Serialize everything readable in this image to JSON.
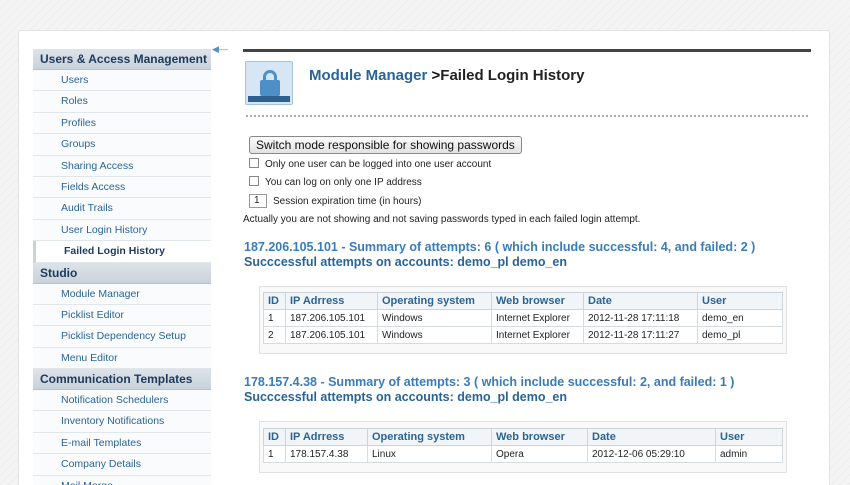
{
  "sidebar": {
    "sections": [
      {
        "title": "Users & Access Management",
        "items": [
          {
            "label": "Users",
            "active": false
          },
          {
            "label": "Roles",
            "active": false
          },
          {
            "label": "Profiles",
            "active": false
          },
          {
            "label": "Groups",
            "active": false
          },
          {
            "label": "Sharing Access",
            "active": false
          },
          {
            "label": "Fields Access",
            "active": false
          },
          {
            "label": "Audit Trails",
            "active": false
          },
          {
            "label": "User Login History",
            "active": false
          },
          {
            "label": "Failed Login History",
            "active": true
          }
        ]
      },
      {
        "title": "Studio",
        "items": [
          {
            "label": "Module Manager",
            "active": false
          },
          {
            "label": "Picklist Editor",
            "active": false
          },
          {
            "label": "Picklist Dependency Setup",
            "active": false
          },
          {
            "label": "Menu Editor",
            "active": false
          }
        ]
      },
      {
        "title": "Communication Templates",
        "items": [
          {
            "label": "Notification Schedulers",
            "active": false
          },
          {
            "label": "Inventory Notifications",
            "active": false
          },
          {
            "label": "E-mail Templates",
            "active": false
          },
          {
            "label": "Company Details",
            "active": false
          },
          {
            "label": "Mail Merge",
            "active": false
          }
        ]
      }
    ]
  },
  "header": {
    "crumb": "Module Manager",
    "separator": " >",
    "title": "Failed Login History"
  },
  "controls": {
    "switch_button": "Switch mode responsible for showing passwords",
    "opt_one_user": "Only one user can be logged into one user account",
    "opt_one_ip": "You can log on only one IP address",
    "session_value": "1",
    "session_label": "Session expiration time (in hours)",
    "note": "Actually you are not showing and not saving passwords typed in each failed login attempt."
  },
  "table_headers": [
    "ID",
    "IP Adrress",
    "Operating system",
    "Web browser",
    "Date",
    "User"
  ],
  "groups": [
    {
      "summary": "187.206.105.101 - Summary of attempts: 6 ( which include successful: 4, and failed: 2 )",
      "accounts": "Succcessful attempts on accounts: demo_pl demo_en",
      "rows": [
        [
          "1",
          "187.206.105.101",
          "Windows",
          "Internet Explorer",
          "2012-11-28 17:11:18",
          "demo_en"
        ],
        [
          "2",
          "187.206.105.101",
          "Windows",
          "Internet Explorer",
          "2012-11-28 17:11:27",
          "demo_pl"
        ]
      ]
    },
    {
      "summary": "178.157.4.38 - Summary of attempts: 3 ( which include successful: 2, and failed: 1 )",
      "accounts": "Succcessful attempts on accounts: demo_pl demo_en",
      "rows": [
        [
          "1",
          "178.157.4.38",
          "Linux",
          "Opera",
          "2012-12-06 05:29:10",
          "admin"
        ]
      ]
    }
  ],
  "colors": {
    "link": "#2a6496",
    "summary": "#3a7cb8",
    "sidebar_header": "#1d3a5c"
  }
}
